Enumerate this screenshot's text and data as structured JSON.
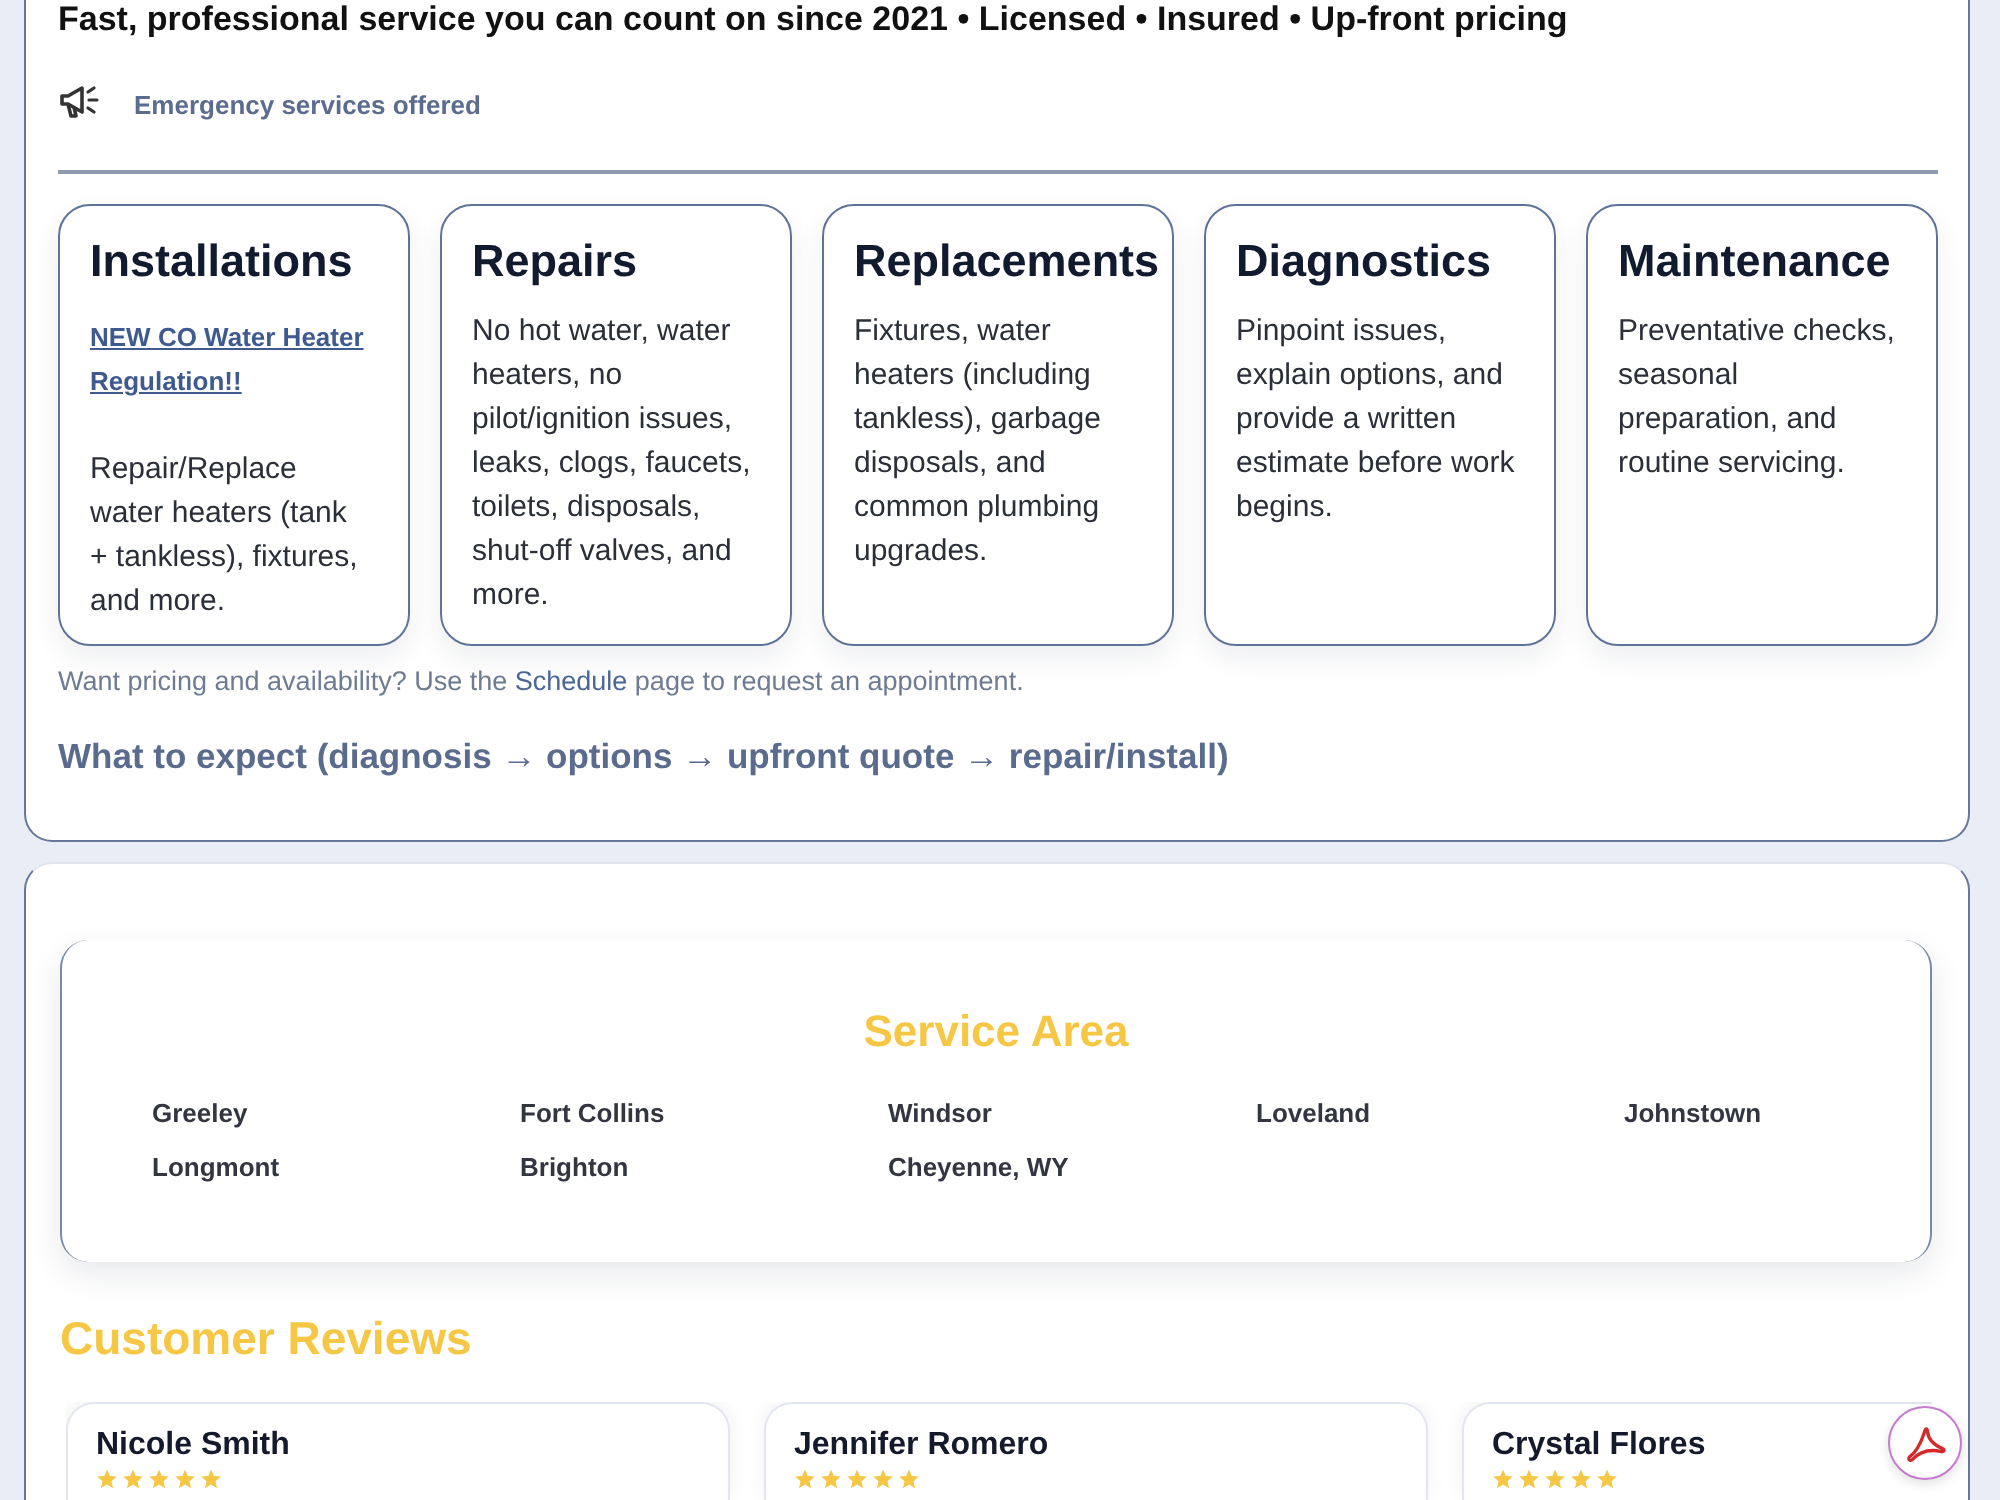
{
  "header": {
    "tagline": "Fast, professional service you can count on since 2021 • Licensed • Insured • Up-front pricing",
    "notice": "Emergency services offered"
  },
  "services": [
    {
      "title": "Installations",
      "link": "NEW CO Water Heater Regulation!!",
      "text": "Repair/Replace water heaters (tank + tankless), fixtures, and more."
    },
    {
      "title": "Repairs",
      "text": "No hot water, water heaters, no pilot/ignition issues, leaks, clogs, faucets, toilets, disposals, shut-off valves, and more."
    },
    {
      "title": "Replacements",
      "text": "Fixtures, water heaters (including tankless), garbage disposals, and common plumbing upgrades."
    },
    {
      "title": "Diagnostics",
      "text": "Pinpoint issues, explain options, and provide a written estimate before work begins."
    },
    {
      "title": "Maintenance",
      "text": "Preventative checks, seasonal preparation, and routine servicing."
    }
  ],
  "pricing_note": {
    "before": "Want pricing and availability? Use the",
    "link": "Schedule",
    "after": "page to request an appointment."
  },
  "expect_heading": "What to expect (diagnosis → options → upfront quote → repair/install)",
  "service_area": {
    "title": "Service Area",
    "cities": [
      "Greeley",
      "Fort Collins",
      "Windsor",
      "Loveland",
      "Johnstown",
      "Longmont",
      "Brighton",
      "Cheyenne, WY"
    ]
  },
  "reviews": {
    "title": "Customer Reviews",
    "items": [
      {
        "name": "Nicole Smith",
        "stars": 5
      },
      {
        "name": "Jennifer Romero",
        "stars": 5
      },
      {
        "name": "Crystal Flores",
        "stars": 5
      }
    ]
  }
}
